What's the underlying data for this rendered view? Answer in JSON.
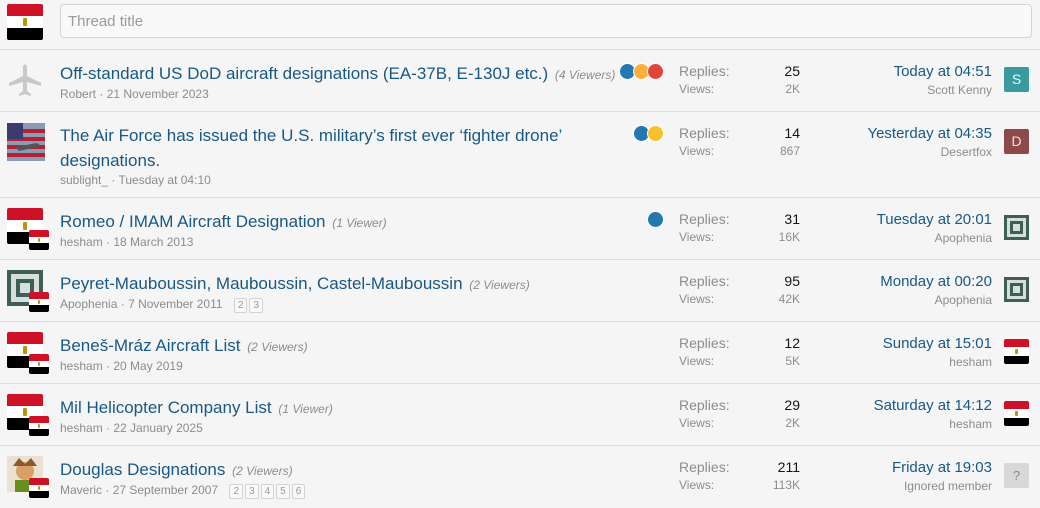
{
  "new_thread": {
    "placeholder": "Thread title"
  },
  "threads": [
    {
      "title": "Off-standard US DoD aircraft designations (EA-37B, E-130J etc.)",
      "viewers": "(4 Viewers)",
      "author": "Robert",
      "date": "21 November 2023",
      "avatar_icon": "airplane-icon",
      "reactions": [
        "like",
        "haha",
        "angry"
      ],
      "replies_label": "Replies:",
      "replies": "25",
      "views_label": "Views:",
      "views": "2K",
      "latest_date": "Today at 04:51",
      "latest_user": "Scott Kenny",
      "latest_avatar_letter": "S",
      "latest_avatar_color": "#3b9aa0"
    },
    {
      "title": "The Air Force has issued the U.S. military’s first ever ‘fighter drone’ designations.",
      "viewers": "",
      "author": "sublight_",
      "date": "Tuesday at 04:10",
      "avatar_icon": "us-flag-icon",
      "reactions": [
        "like",
        "wow"
      ],
      "replies_label": "Replies:",
      "replies": "14",
      "views_label": "Views:",
      "views": "867",
      "latest_date": "Yesterday at 04:35",
      "latest_user": "Desertfox",
      "latest_avatar_letter": "D",
      "latest_avatar_color": "#8c4a4a"
    },
    {
      "title": "Romeo / IMAM Aircraft Designation",
      "viewers": "(1 Viewer)",
      "author": "hesham",
      "date": "18 March 2013",
      "avatar_icon": "egypt-flag-icon",
      "reactions": [
        "like"
      ],
      "replies_label": "Replies:",
      "replies": "31",
      "views_label": "Views:",
      "views": "16K",
      "latest_date": "Tuesday at 20:01",
      "latest_user": "Apophenia"
    },
    {
      "title": "Peyret-Mauboussin, Mauboussin, Castel-Mauboussin",
      "viewers": "(2 Viewers)",
      "author": "Apophenia",
      "date": "7 November 2011",
      "pages": [
        "2",
        "3"
      ],
      "avatar_icon": "apophenia-avatar-icon",
      "reactions": [],
      "replies_label": "Replies:",
      "replies": "95",
      "views_label": "Views:",
      "views": "42K",
      "latest_date": "Monday at 00:20",
      "latest_user": "Apophenia"
    },
    {
      "title": "Beneš-Mráz Aircraft List",
      "viewers": "(2 Viewers)",
      "author": "hesham",
      "date": "20 May 2019",
      "avatar_icon": "egypt-flag-icon",
      "reactions": [],
      "replies_label": "Replies:",
      "replies": "12",
      "views_label": "Views:",
      "views": "5K",
      "latest_date": "Sunday at 15:01",
      "latest_user": "hesham"
    },
    {
      "title": "Mil Helicopter Company List",
      "viewers": "(1 Viewer)",
      "author": "hesham",
      "date": "22 January 2025",
      "avatar_icon": "egypt-flag-icon",
      "reactions": [],
      "replies_label": "Replies:",
      "replies": "29",
      "views_label": "Views:",
      "views": "2K",
      "latest_date": "Saturday at 14:12",
      "latest_user": "hesham"
    },
    {
      "title": "Douglas Designations",
      "viewers": "(2 Viewers)",
      "author": "Maveric",
      "date": "27 September 2007",
      "pages": [
        "2",
        "3",
        "4",
        "5",
        "6"
      ],
      "avatar_icon": "character-avatar-icon",
      "reactions": [],
      "replies_label": "Replies:",
      "replies": "211",
      "views_label": "Views:",
      "views": "113K",
      "latest_date": "Friday at 19:03",
      "latest_user": "Ignored member",
      "latest_avatar_letter": "?"
    }
  ]
}
